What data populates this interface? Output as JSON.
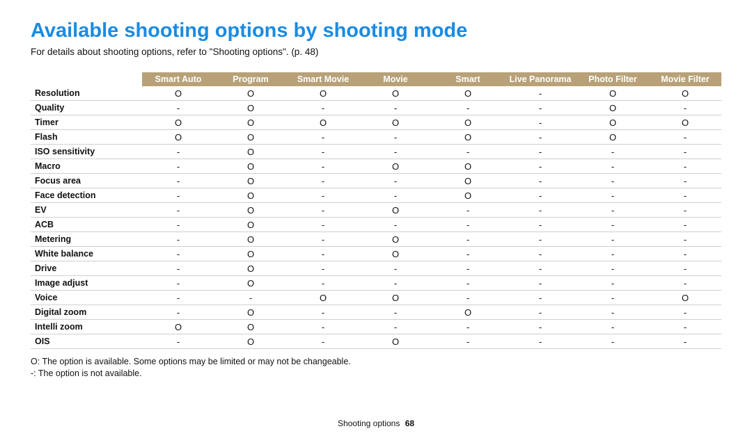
{
  "title": "Available shooting options by shooting mode",
  "subtitle": "For details about shooting options, refer to \"Shooting options\". (p. 48)",
  "columns": [
    "Smart Auto",
    "Program",
    "Smart Movie",
    "Movie",
    "Smart",
    "Live Panorama",
    "Photo Filter",
    "Movie Filter"
  ],
  "rows": [
    {
      "label": "Resolution",
      "cells": [
        "O",
        "O",
        "O",
        "O",
        "O",
        "-",
        "O",
        "O"
      ]
    },
    {
      "label": "Quality",
      "cells": [
        "-",
        "O",
        "-",
        "-",
        "-",
        "-",
        "O",
        "-"
      ]
    },
    {
      "label": "Timer",
      "cells": [
        "O",
        "O",
        "O",
        "O",
        "O",
        "-",
        "O",
        "O"
      ]
    },
    {
      "label": "Flash",
      "cells": [
        "O",
        "O",
        "-",
        "-",
        "O",
        "-",
        "O",
        "-"
      ]
    },
    {
      "label": "ISO sensitivity",
      "cells": [
        "-",
        "O",
        "-",
        "-",
        "-",
        "-",
        "-",
        "-"
      ]
    },
    {
      "label": "Macro",
      "cells": [
        "-",
        "O",
        "-",
        "O",
        "O",
        "-",
        "-",
        "-"
      ]
    },
    {
      "label": "Focus area",
      "cells": [
        "-",
        "O",
        "-",
        "-",
        "O",
        "-",
        "-",
        "-"
      ]
    },
    {
      "label": "Face detection",
      "cells": [
        "-",
        "O",
        "-",
        "-",
        "O",
        "-",
        "-",
        "-"
      ]
    },
    {
      "label": "EV",
      "cells": [
        "-",
        "O",
        "-",
        "O",
        "-",
        "-",
        "-",
        "-"
      ]
    },
    {
      "label": "ACB",
      "cells": [
        "-",
        "O",
        "-",
        "-",
        "-",
        "-",
        "-",
        "-"
      ]
    },
    {
      "label": "Metering",
      "cells": [
        "-",
        "O",
        "-",
        "O",
        "-",
        "-",
        "-",
        "-"
      ]
    },
    {
      "label": "White balance",
      "cells": [
        "-",
        "O",
        "-",
        "O",
        "-",
        "-",
        "-",
        "-"
      ]
    },
    {
      "label": "Drive",
      "cells": [
        "-",
        "O",
        "-",
        "-",
        "-",
        "-",
        "-",
        "-"
      ]
    },
    {
      "label": "Image adjust",
      "cells": [
        "-",
        "O",
        "-",
        "-",
        "-",
        "-",
        "-",
        "-"
      ]
    },
    {
      "label": "Voice",
      "cells": [
        "-",
        "-",
        "O",
        "O",
        "-",
        "-",
        "-",
        "O"
      ]
    },
    {
      "label": "Digital zoom",
      "cells": [
        "-",
        "O",
        "-",
        "-",
        "O",
        "-",
        "-",
        "-"
      ]
    },
    {
      "label": "Intelli zoom",
      "cells": [
        "O",
        "O",
        "-",
        "-",
        "-",
        "-",
        "-",
        "-"
      ]
    },
    {
      "label": "OIS",
      "cells": [
        "-",
        "O",
        "-",
        "O",
        "-",
        "-",
        "-",
        "-"
      ]
    }
  ],
  "note1": "O: The option is available. Some options may be limited or may not be changeable.",
  "note2": "-: The option is not available.",
  "footer_label": "Shooting options",
  "footer_page": "68",
  "chart_data": {
    "type": "table",
    "title": "Available shooting options by shooting mode",
    "columns": [
      "Smart Auto",
      "Program",
      "Smart Movie",
      "Movie",
      "Smart",
      "Live Panorama",
      "Photo Filter",
      "Movie Filter"
    ],
    "rows": [
      "Resolution",
      "Quality",
      "Timer",
      "Flash",
      "ISO sensitivity",
      "Macro",
      "Focus area",
      "Face detection",
      "EV",
      "ACB",
      "Metering",
      "White balance",
      "Drive",
      "Image adjust",
      "Voice",
      "Digital zoom",
      "Intelli zoom",
      "OIS"
    ],
    "legend": {
      "O": "available",
      "-": "not available"
    },
    "matrix": [
      [
        "O",
        "O",
        "O",
        "O",
        "O",
        "-",
        "O",
        "O"
      ],
      [
        "-",
        "O",
        "-",
        "-",
        "-",
        "-",
        "O",
        "-"
      ],
      [
        "O",
        "O",
        "O",
        "O",
        "O",
        "-",
        "O",
        "O"
      ],
      [
        "O",
        "O",
        "-",
        "-",
        "O",
        "-",
        "O",
        "-"
      ],
      [
        "-",
        "O",
        "-",
        "-",
        "-",
        "-",
        "-",
        "-"
      ],
      [
        "-",
        "O",
        "-",
        "O",
        "O",
        "-",
        "-",
        "-"
      ],
      [
        "-",
        "O",
        "-",
        "-",
        "O",
        "-",
        "-",
        "-"
      ],
      [
        "-",
        "O",
        "-",
        "-",
        "O",
        "-",
        "-",
        "-"
      ],
      [
        "-",
        "O",
        "-",
        "O",
        "-",
        "-",
        "-",
        "-"
      ],
      [
        "-",
        "O",
        "-",
        "-",
        "-",
        "-",
        "-",
        "-"
      ],
      [
        "-",
        "O",
        "-",
        "O",
        "-",
        "-",
        "-",
        "-"
      ],
      [
        "-",
        "O",
        "-",
        "O",
        "-",
        "-",
        "-",
        "-"
      ],
      [
        "-",
        "O",
        "-",
        "-",
        "-",
        "-",
        "-",
        "-"
      ],
      [
        "-",
        "O",
        "-",
        "-",
        "-",
        "-",
        "-",
        "-"
      ],
      [
        "-",
        "-",
        "O",
        "O",
        "-",
        "-",
        "-",
        "O"
      ],
      [
        "-",
        "O",
        "-",
        "-",
        "O",
        "-",
        "-",
        "-"
      ],
      [
        "O",
        "O",
        "-",
        "-",
        "-",
        "-",
        "-",
        "-"
      ],
      [
        "-",
        "O",
        "-",
        "O",
        "-",
        "-",
        "-",
        "-"
      ]
    ]
  }
}
